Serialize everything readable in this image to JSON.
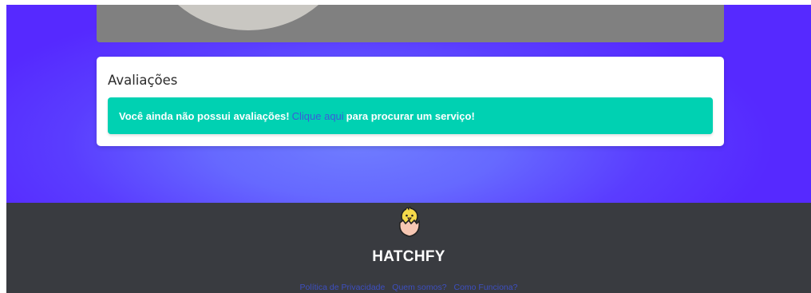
{
  "reviews": {
    "title": "Avaliações",
    "empty_message_before": "Você ainda não possui avaliações!",
    "link_text": "Clique aqui",
    "empty_message_after": "para procurar um serviço!"
  },
  "footer": {
    "brand": "HATCHFY",
    "logo_icon": "hatching-chick-icon",
    "links": [
      "Política de Privacidade",
      "Quem somos?",
      "Como Funciona?"
    ]
  },
  "colors": {
    "hero_gradient": "#5629ff",
    "alert_bg": "#00d1b2",
    "link": "#3b5bdb",
    "footer_bg": "#393b40"
  }
}
